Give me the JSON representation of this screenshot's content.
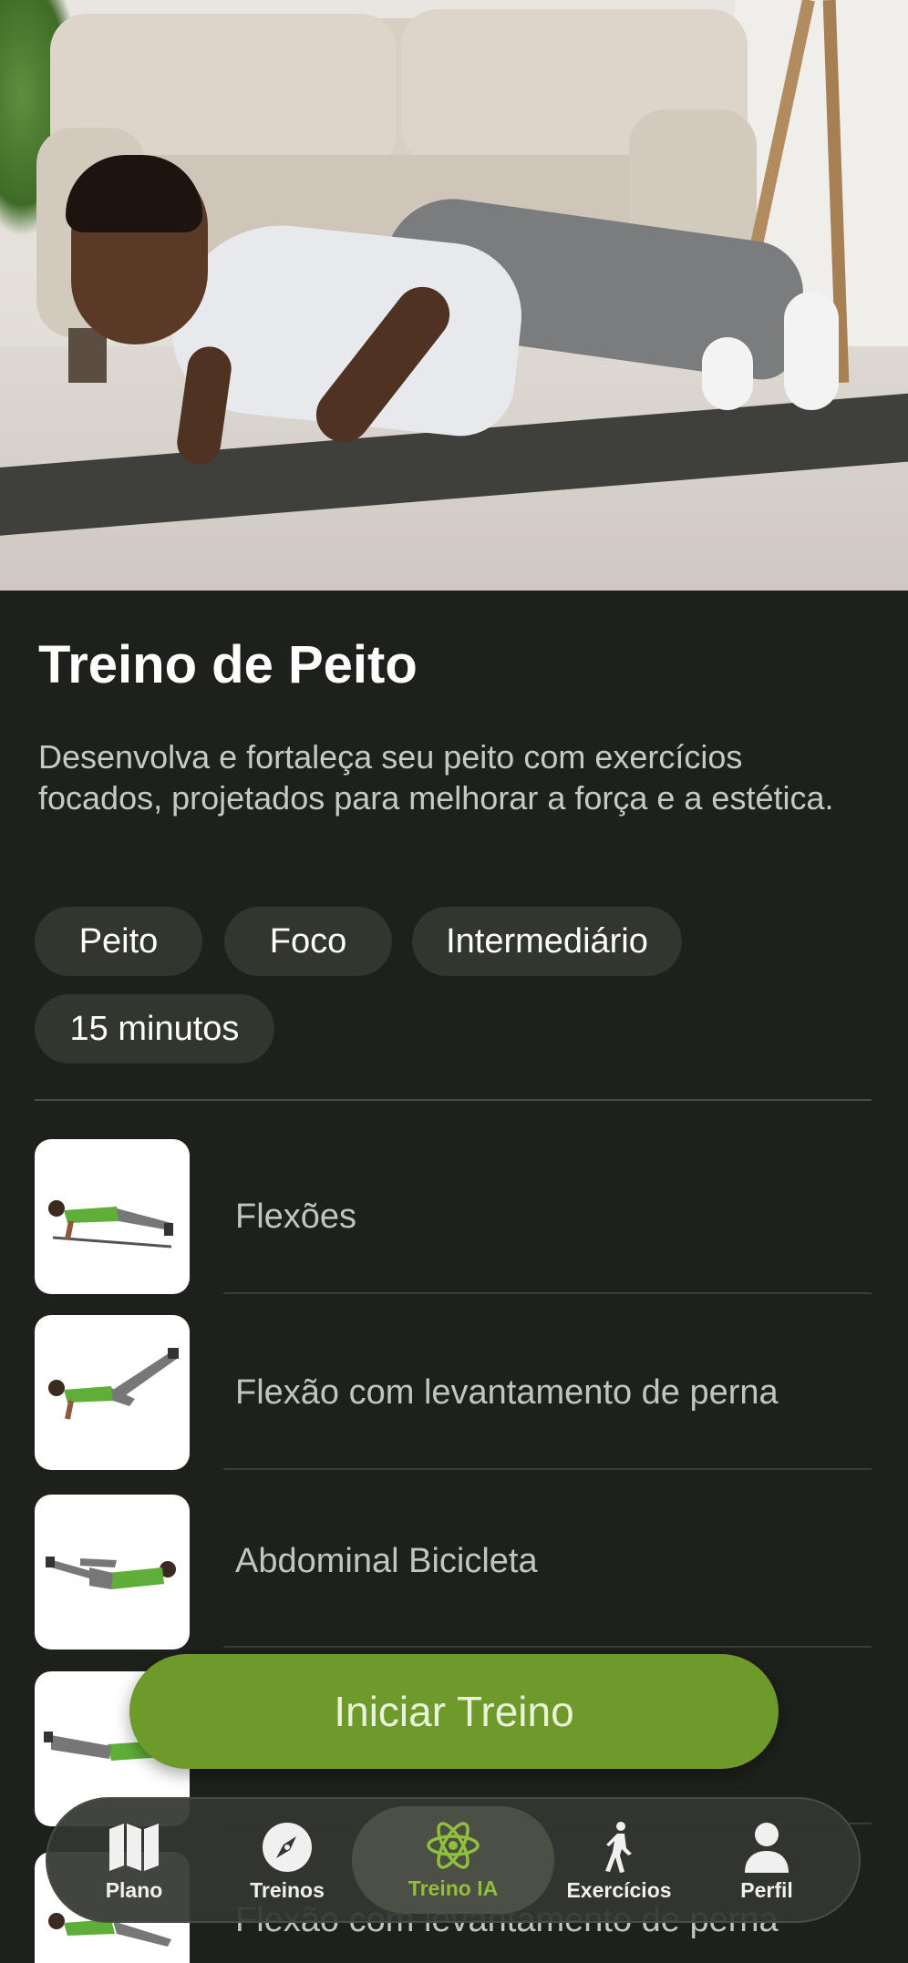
{
  "hero": {
    "image": "man-doing-pushup-photo"
  },
  "workout": {
    "title": "Treino de Peito",
    "description": "Desenvolva e fortaleça seu peito com exercícios focados, projetados para melhorar a força e a estética.",
    "tags": [
      "Peito",
      "Foco",
      "Intermediário",
      "15 minutos"
    ]
  },
  "exercises": [
    {
      "name": "Flexões"
    },
    {
      "name": "Flexão com levantamento de perna"
    },
    {
      "name": "Abdominal Bicicleta"
    },
    {
      "name": ""
    },
    {
      "name": "Flexão com levantamento de perna"
    }
  ],
  "cta": {
    "label": "Iniciar Treino"
  },
  "nav": {
    "items": [
      {
        "label": "Plano",
        "icon": "map-icon"
      },
      {
        "label": "Treinos",
        "icon": "compass-icon"
      },
      {
        "label": "Treino IA",
        "icon": "atom-icon",
        "active": true
      },
      {
        "label": "Exercícios",
        "icon": "walking-person-icon"
      },
      {
        "label": "Perfil",
        "icon": "person-icon"
      }
    ]
  },
  "colors": {
    "accent": "#6e9a2b",
    "active_label": "#8fbf3c",
    "background": "#1e201b"
  }
}
